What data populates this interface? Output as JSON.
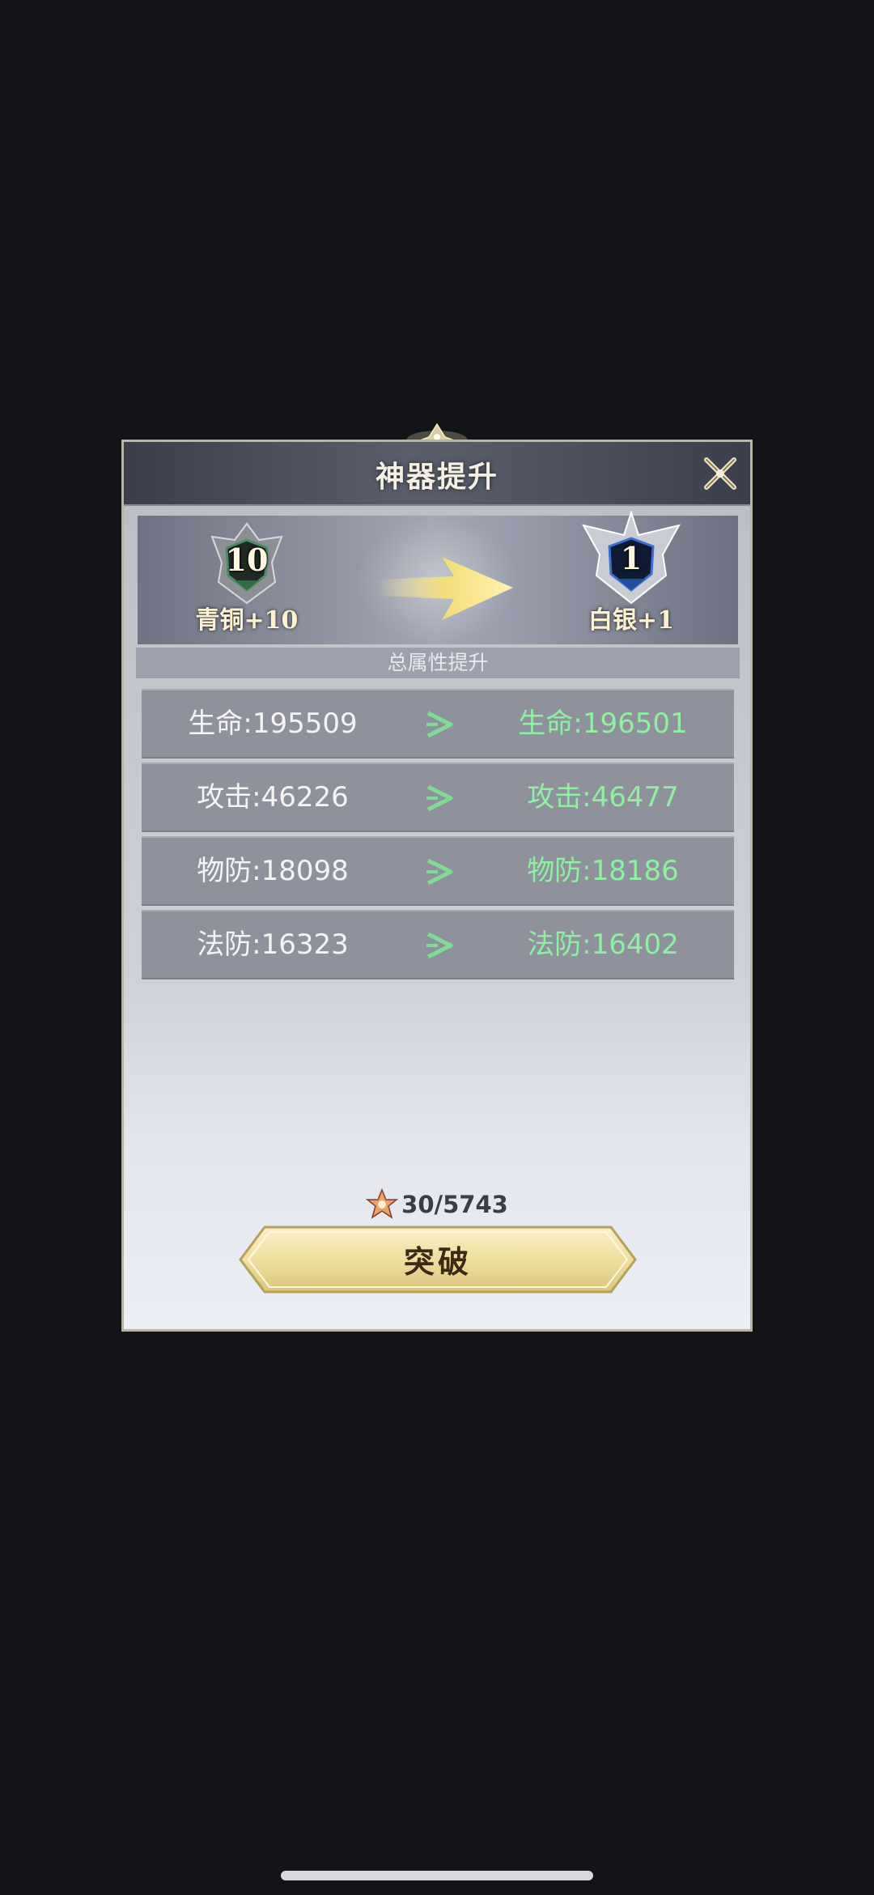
{
  "dialog": {
    "title": "神器提升",
    "close_icon": "close-x-icon"
  },
  "rank": {
    "current": {
      "number": "10",
      "label": "青铜+10",
      "badge_icon": "bronze-shield-icon",
      "color": "#2f6b45"
    },
    "next": {
      "number": "1",
      "label": "白银+1",
      "badge_icon": "silver-shield-icon",
      "color": "#1f4e9a"
    },
    "arrow_icon": "gold-arrow-icon"
  },
  "section": {
    "title": "总属性提升"
  },
  "stats": [
    {
      "current": "生命:195509",
      "next": "生命:196501"
    },
    {
      "current": "攻击:46226",
      "next": "攻击:46477"
    },
    {
      "current": "物防:18098",
      "next": "物防:18186"
    },
    {
      "current": "法防:16323",
      "next": "法防:16402"
    }
  ],
  "cost": {
    "icon": "star-shard-icon",
    "text": "30/5743"
  },
  "actions": {
    "break_label": "突破"
  },
  "colors": {
    "upgrade_value": "#8ef0a0",
    "button_gold": "#efe3a6"
  }
}
